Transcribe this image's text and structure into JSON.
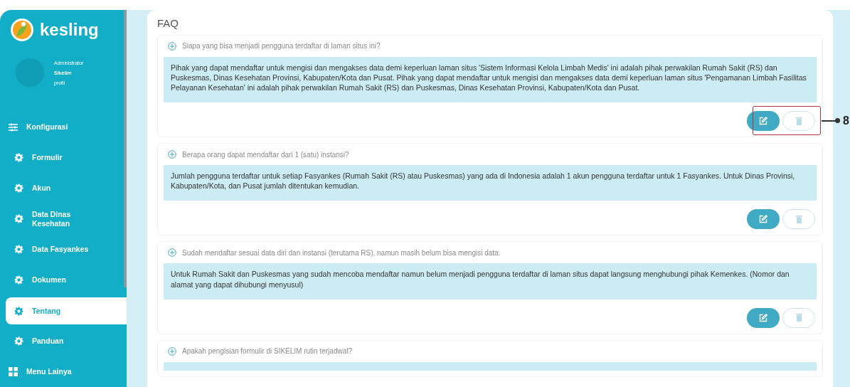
{
  "sidebar": {
    "brand": "kesling",
    "profile": {
      "role": "Administrator",
      "name": "Sikelim",
      "link": "profil"
    },
    "items": [
      {
        "label": "Konfigurasi",
        "kind": "sliders",
        "sub": false,
        "selected": false
      },
      {
        "label": "Formulir",
        "kind": "gear",
        "sub": true,
        "selected": false
      },
      {
        "label": "Akun",
        "kind": "gear",
        "sub": true,
        "selected": false
      },
      {
        "label": "Data Dinas Kesehatan",
        "kind": "gear",
        "sub": true,
        "selected": false
      },
      {
        "label": "Data Fasyankes",
        "kind": "gear",
        "sub": true,
        "selected": false
      },
      {
        "label": "Dokumen",
        "kind": "gear",
        "sub": true,
        "selected": false
      },
      {
        "label": "Tentang",
        "kind": "gear",
        "sub": true,
        "selected": true
      },
      {
        "label": "Panduan",
        "kind": "gear",
        "sub": true,
        "selected": false
      },
      {
        "label": "Menu Lainya",
        "kind": "grid",
        "sub": false,
        "selected": false
      }
    ]
  },
  "page": {
    "title": "FAQ",
    "faqs": [
      {
        "question": "Siapa yang bisa menjadi pengguna terdaftar di laman situs ini?",
        "answer": "Pihak yang dapat mendaftar untuk mengisi dan mengakses data demi keperluan laman situs 'Sistem Informasi Kelola Limbah Medis' ini adalah pihak perwakilan Rumah Sakit (RS) dan Puskesmas, Dinas Kesehatan Provinsi, Kabupaten/Kota dan Pusat. Pihak yang dapat mendaftar untuk mengisi dan mengakses data demi keperluan laman situs 'Pengamanan Limbah Fasilitas Pelayanan Kesehatan' ini adalah pihak perwakilan Rumah Sakit (RS) dan Puskesmas, Dinas Kesehatan Provinsi, Kabupaten/Kota dan Pusat.",
        "callout": "8"
      },
      {
        "question": "Berapa orang dapat mendaftar dari 1 (satu) instansi?",
        "answer": "Jumlah pengguna terdaftar untuk setiap Fasyankes (Rumah Sakit (RS) atau Puskesmas) yang ada di Indonesia adalah 1 akun pengguna terdaftar untuk 1 Fasyankes. Untuk Dinas Provinsi, Kabupaten/Kota, dan Pusat jumlah ditentukan kemudian."
      },
      {
        "question": "Sudah mendaftar sesuai data diri dan instansi (terutama RS), namun masih belum bisa mengisi data.",
        "answer": "Untuk Rumah Sakit dan Puskesmas yang sudah mencoba mendaftar namun belum menjadi pengguna terdaftar di laman situs dapat langsung menghubungi pihak Kemenkes. (Nomor dan alamat yang dapat dihubungi menyusul)"
      },
      {
        "question": "Apakah pengisian formulir di SIKELIM rutin terjadwal?"
      }
    ]
  }
}
